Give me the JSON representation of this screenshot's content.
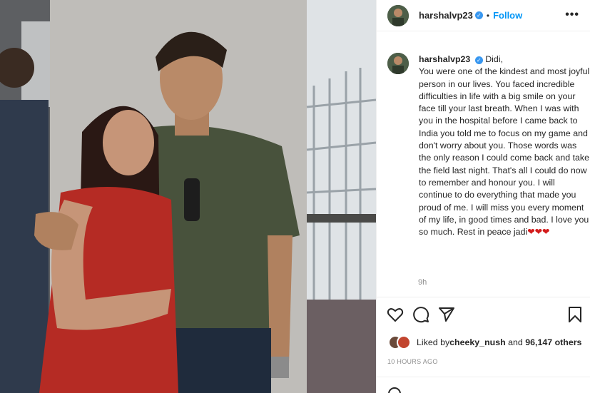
{
  "post": {
    "username": "harshalvp23",
    "verified_glyph": "✓",
    "separator": "•",
    "follow_label": "Follow",
    "more_label": "•••",
    "caption_username": "harshalvp23",
    "caption_text": "Didi,\nYou were one of the kindest and most joyful person in our lives. You faced incredible difficulties in life with a big smile on your face till your last breath. When I was with you in the hospital before I came back to India you told me to focus on my game and don't worry about you. Those words was the only reason I could come back and take the field last night. That's all I could do now to remember and honour you. I will continue to do everything that made you proud of me. I will miss you every moment of my life, in good times and bad. I love you so much. Rest in peace jadi",
    "caption_hearts": "❤❤❤",
    "relative_time": "9h",
    "likes_prefix": "Liked by ",
    "likes_user": "cheeky_nush",
    "likes_middle": " and ",
    "likes_count": "96,147 others",
    "posted_ago": "10 HOURS AGO"
  },
  "icons": {
    "header_avatar": "avatar-icon",
    "like": "heart-icon",
    "comment": "comment-icon",
    "share": "send-icon",
    "save": "bookmark-icon",
    "emoji": "emoji-icon"
  },
  "colors": {
    "accent": "#0095f6",
    "verified": "#3897f0",
    "heart": "#d31a1a",
    "muted": "#8e8e8e",
    "text": "#262626"
  }
}
